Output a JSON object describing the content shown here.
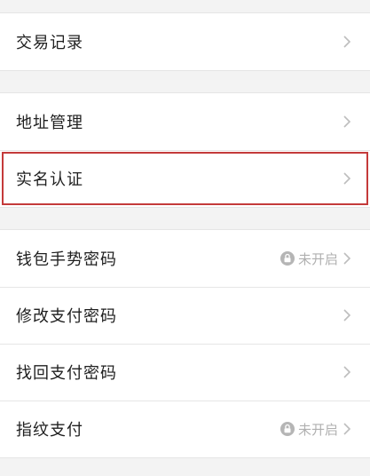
{
  "groups": [
    {
      "items": [
        {
          "label": "交易记录"
        }
      ]
    },
    {
      "items": [
        {
          "label": "地址管理"
        },
        {
          "label": "实名认证"
        }
      ]
    },
    {
      "items": [
        {
          "label": "钱包手势密码",
          "status": "未开启"
        },
        {
          "label": "修改支付密码"
        },
        {
          "label": "找回支付密码"
        },
        {
          "label": "指纹支付",
          "status": "未开启"
        }
      ]
    }
  ],
  "colors": {
    "highlight_border": "#c43a3a",
    "status_text": "#b0b0b0"
  },
  "icons": {
    "chevron": "chevron-right-icon",
    "lock": "lock-icon"
  }
}
